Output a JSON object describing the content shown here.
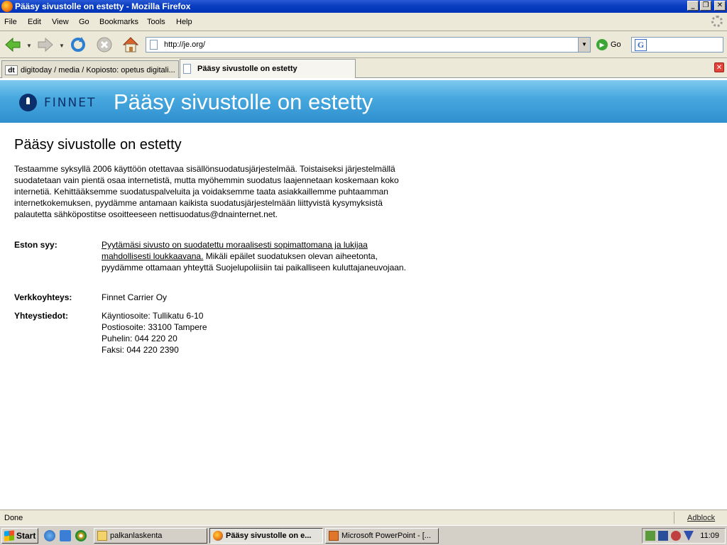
{
  "window": {
    "title": "Pääsy sivustolle on estetty - Mozilla Firefox"
  },
  "menu": [
    "File",
    "Edit",
    "View",
    "Go",
    "Bookmarks",
    "Tools",
    "Help"
  ],
  "navbar": {
    "url": "http://je.org/",
    "go_label": "Go"
  },
  "tabs": [
    {
      "label": "digitoday / media / Kopiosto: opetus digitali..."
    },
    {
      "label": "Pääsy sivustolle on estetty"
    }
  ],
  "banner": {
    "logo_text": "FINNET",
    "title": "Pääsy sivustolle on estetty"
  },
  "page": {
    "heading": "Pääsy sivustolle on estetty",
    "intro": "Testaamme syksyllä 2006 käyttöön otettavaa sisällönsuodatusjärjestelmää. Toistaiseksi järjestelmällä suodatetaan vain pientä osaa internetistä, mutta myöhemmin suodatus laajennetaan koskemaan koko internetiä. Kehittääksemme suodatuspalveluita ja voidaksemme taata asiakkaillemme puhtaamman internetkokemuksen, pyydämme antamaan kaikista suodatusjärjestelmään liittyvistä kysymyksistä palautetta sähköpostitse osoitteeseen nettisuodatus@dnainternet.net.",
    "reason_label": "Eston syy:",
    "reason_link": "Pyytämäsi sivusto on suodatettu moraalisesti sopimattomana ja lukijaa mahdollisesti loukkaavana.",
    "reason_rest": " Mikäli epäilet suodatuksen olevan aiheetonta, pyydämme ottamaan yhteyttä Suojelupoliisiin tai paikalliseen kuluttajaneuvojaan.",
    "network_label": "Verkkoyhteys:",
    "network_value": "Finnet Carrier Oy",
    "contact_label": "Yhteystiedot:",
    "contact_lines": [
      "Käyntiosoite: Tullikatu 6-10",
      "Postiosoite: 33100 Tampere",
      "Puhelin: 044 220 20",
      "Faksi: 044 220 2390"
    ]
  },
  "status": {
    "text": "Done",
    "adblock": "Adblock"
  },
  "taskbar": {
    "start": "Start",
    "buttons": [
      {
        "label": "palkanlaskenta"
      },
      {
        "label": "Pääsy sivustolle on e..."
      },
      {
        "label": "Microsoft PowerPoint - [..."
      }
    ],
    "clock": "11:09"
  },
  "colors": {
    "banner": "#48a9df",
    "logo_navy": "#0b2f6a",
    "titlebar": "#0a3dbf"
  }
}
